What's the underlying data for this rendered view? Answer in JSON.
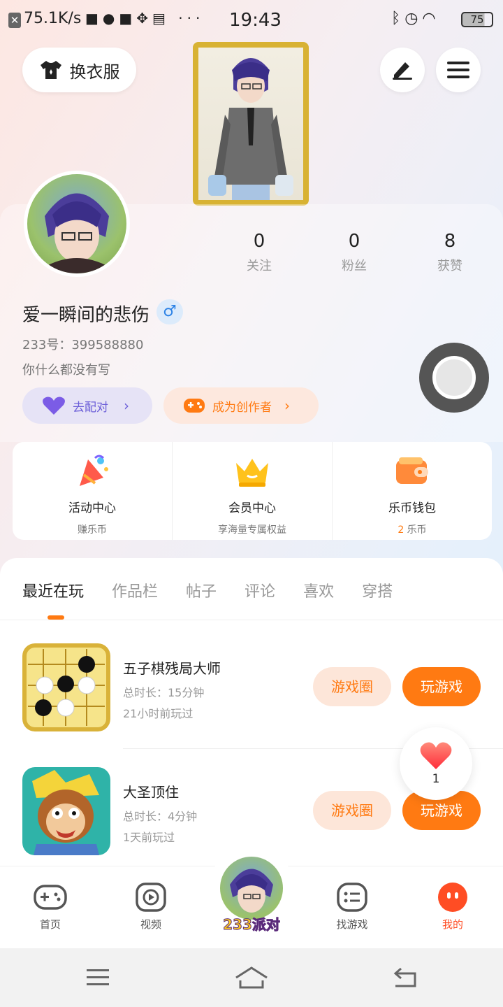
{
  "status_bar": {
    "speed": "75.1K/s",
    "time": "19:43",
    "battery": "75",
    "more": "···"
  },
  "top": {
    "outfit_label": "换衣服"
  },
  "profile": {
    "username": "爱一瞬间的悲伤",
    "gender_symbol": "♂",
    "uid": "233号：399588880",
    "bio": "你什么都没有写",
    "stats": [
      {
        "value": "0",
        "label": "关注"
      },
      {
        "value": "0",
        "label": "粉丝"
      },
      {
        "value": "8",
        "label": "获赞"
      }
    ],
    "match_label": "去配对",
    "creator_label": "成为创作者"
  },
  "quick_menu": [
    {
      "title": "活动中心",
      "sub": "赚乐币"
    },
    {
      "title": "会员中心",
      "sub": "享海量专属权益"
    },
    {
      "title": "乐币钱包",
      "sub_num": "2",
      "sub": " 乐币"
    }
  ],
  "tabs": [
    "最近在玩",
    "作品栏",
    "帖子",
    "评论",
    "喜欢",
    "穿搭"
  ],
  "games": [
    {
      "name": "五子棋残局大师",
      "duration": "总时长：15分钟",
      "last_played": "21小时前玩过",
      "circle_label": "游戏圈",
      "play_label": "玩游戏"
    },
    {
      "name": "大圣顶住",
      "duration": "总时长：4分钟",
      "last_played": "1天前玩过",
      "circle_label": "游戏圈",
      "play_label": "玩游戏"
    }
  ],
  "like_float": {
    "count": "1"
  },
  "bottom_nav": [
    {
      "label": "首页"
    },
    {
      "label": "视频"
    },
    {
      "label": "找游戏"
    },
    {
      "label": "我的"
    }
  ],
  "party_label": "233派对",
  "colors": {
    "accent": "#ff7a12",
    "active_nav": "#ff4d24",
    "match": "#6c5fd8"
  }
}
